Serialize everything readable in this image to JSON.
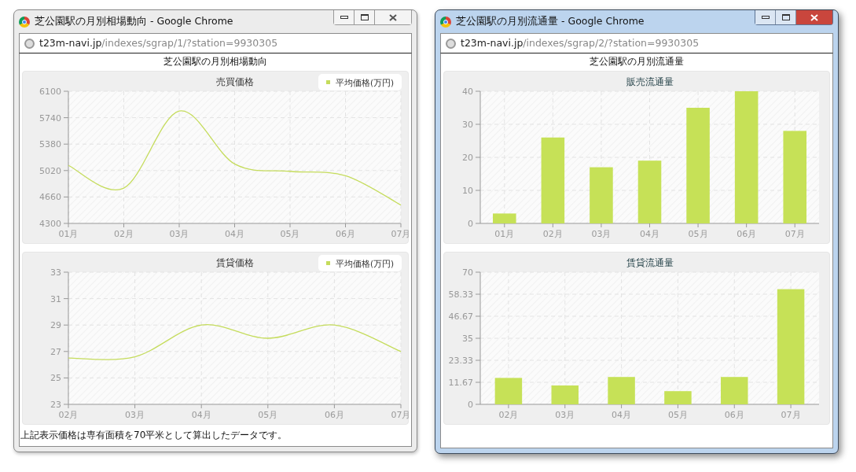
{
  "windows": [
    {
      "title": "芝公園駅の月別相場動向 - Google Chrome",
      "active": false,
      "url_host": "t23m-navi.jp",
      "url_path": "/indexes/sgrap/1/?station=9930305",
      "page_title": "芝公園駅の月別相場動向",
      "charts": [
        {
          "chart_data": {
            "type": "line",
            "title": "売買価格",
            "categories": [
              "01月",
              "02月",
              "03月",
              "04月",
              "05月",
              "06月",
              "07月"
            ],
            "series": [
              {
                "name": "平均価格(万円)",
                "color": "#c5dc5c",
                "values": [
                  5090,
                  4780,
                  5830,
                  5110,
                  5010,
                  4950,
                  4550
                ]
              }
            ],
            "ylim": [
              4300,
              6100
            ],
            "yticks": [
              4300,
              4660,
              5020,
              5380,
              5740,
              6100
            ],
            "grid": true
          }
        },
        {
          "chart_data": {
            "type": "line",
            "title": "賃貸価格",
            "categories": [
              "02月",
              "03月",
              "04月",
              "05月",
              "06月",
              "07月"
            ],
            "series": [
              {
                "name": "平均価格(万円)",
                "color": "#c5dc5c",
                "values": [
                  26.5,
                  26.6,
                  29,
                  28,
                  29,
                  27
                ]
              }
            ],
            "ylim": [
              23,
              33
            ],
            "yticks": [
              23,
              25,
              27,
              29,
              31,
              33
            ],
            "grid": true
          }
        }
      ],
      "footnote": "上記表示価格は専有面積を70平米として算出したデータです。"
    },
    {
      "title": "芝公園駅の月別流通量 - Google Chrome",
      "active": true,
      "url_host": "t23m-navi.jp",
      "url_path": "/indexes/sgrap/2/?station=9930305",
      "page_title": "芝公園駅の月別流通量",
      "charts": [
        {
          "chart_data": {
            "type": "bar",
            "title": "販売流通量",
            "categories": [
              "01月",
              "02月",
              "03月",
              "04月",
              "05月",
              "06月",
              "07月"
            ],
            "series": [
              {
                "color": "#c6e157",
                "values": [
                  3,
                  26,
                  17,
                  19,
                  35,
                  40,
                  28
                ]
              }
            ],
            "ylim": [
              0,
              40
            ],
            "yticks": [
              0,
              10,
              20,
              30,
              40
            ],
            "grid": true
          }
        },
        {
          "chart_data": {
            "type": "bar",
            "title": "賃貸流通量",
            "categories": [
              "02月",
              "03月",
              "04月",
              "05月",
              "06月",
              "07月"
            ],
            "series": [
              {
                "color": "#c6e157",
                "values": [
                  14,
                  10,
                  14.5,
                  7,
                  14.5,
                  61
                ]
              }
            ],
            "ylim": [
              0,
              70
            ],
            "yticks": [
              0,
              11.67,
              23.33,
              35,
              46.67,
              58.33,
              70
            ],
            "grid": true
          }
        }
      ]
    }
  ]
}
